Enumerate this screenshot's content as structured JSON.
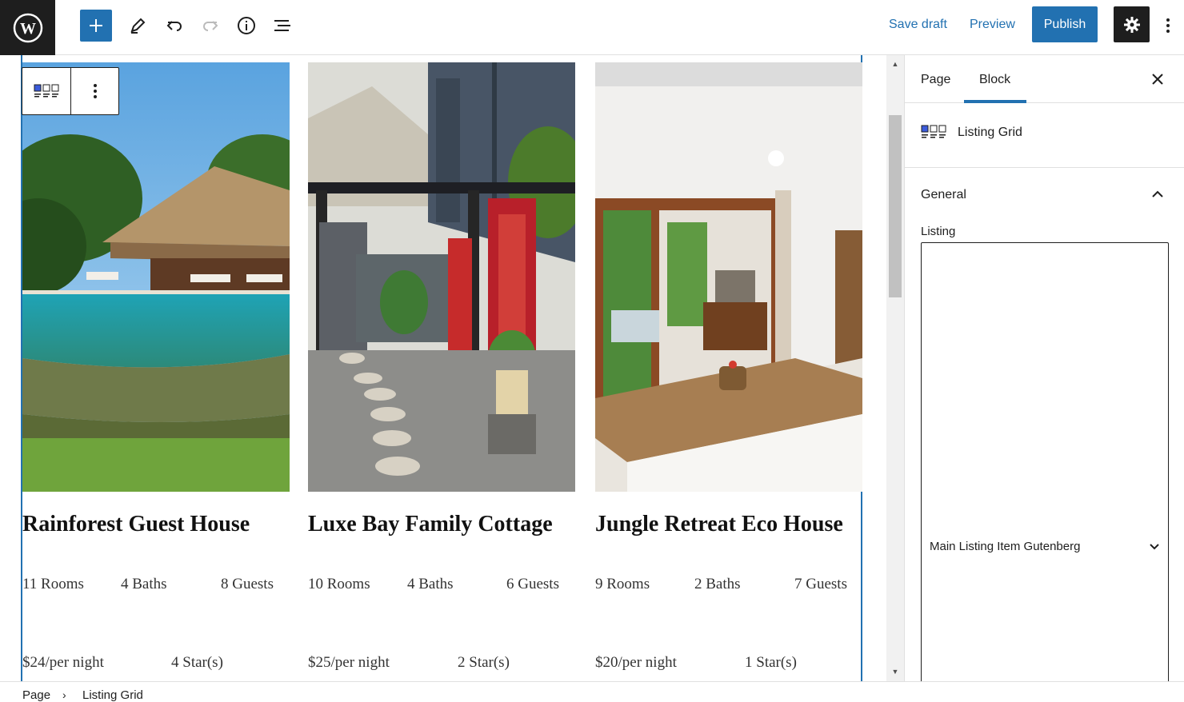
{
  "header": {
    "save_draft": "Save draft",
    "preview": "Preview",
    "publish": "Publish",
    "icons": [
      "wordpress-logo",
      "plus",
      "pencil",
      "undo",
      "redo",
      "info",
      "list-view",
      "gear",
      "more-vertical"
    ]
  },
  "listings": [
    {
      "title": "Rainforest Guest House",
      "rooms": "11 Rooms",
      "baths": "4 Baths",
      "guests": "8 Guests",
      "price": "$24/per night",
      "stars": "4 Star(s)"
    },
    {
      "title": "Luxe Bay Family Cottage",
      "rooms": "10 Rooms",
      "baths": "4 Baths",
      "guests": "6 Guests",
      "price": "$25/per night",
      "stars": "2 Star(s)"
    },
    {
      "title": "Jungle Retreat Eco House",
      "rooms": "9 Rooms",
      "baths": "2 Baths",
      "guests": "7 Guests",
      "price": "$20/per night",
      "stars": "1 Star(s)"
    }
  ],
  "sidebar": {
    "tabs": [
      "Page",
      "Block"
    ],
    "active_tab": "Block",
    "block_name": "Listing Grid",
    "panel_title": "General",
    "listing_label": "Listing",
    "listing_value": "Main Listing Item Gutenberg"
  },
  "breadcrumb": {
    "items": [
      "Page",
      "Listing Grid"
    ]
  },
  "colors": {
    "accent": "#2271b1",
    "dark": "#1e1e1e"
  }
}
